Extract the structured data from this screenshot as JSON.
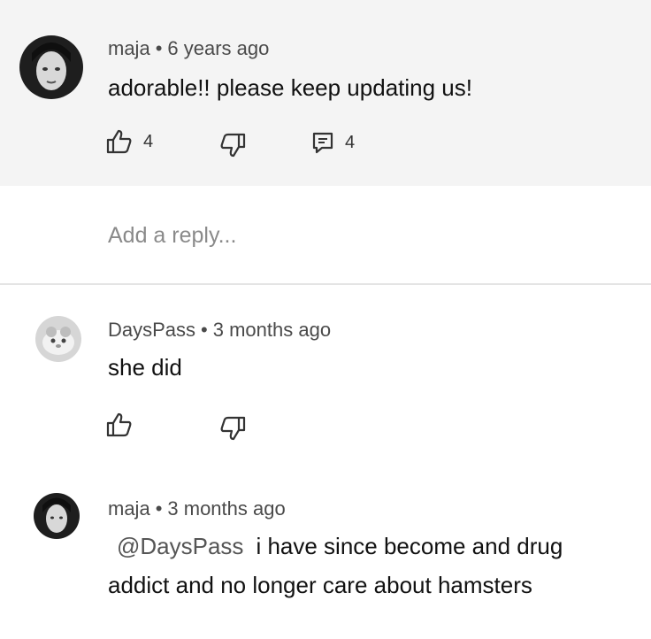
{
  "comments": [
    {
      "author": "maja",
      "time": "6 years ago",
      "text": "adorable!! please keep updating us!",
      "likes": "4",
      "replies": "4"
    },
    {
      "author": "DaysPass",
      "time": "3 months ago",
      "text": "she did"
    },
    {
      "author": "maja",
      "time": "3 months ago",
      "mention": "@DaysPass",
      "text_line1": "i have since become and drug",
      "text_line2": "addict and no longer care about hamsters"
    }
  ],
  "reply_box": {
    "placeholder": "Add a reply..."
  },
  "separator": "•",
  "icons": [
    "thumbs-up-icon",
    "thumbs-down-icon",
    "reply-icon"
  ]
}
